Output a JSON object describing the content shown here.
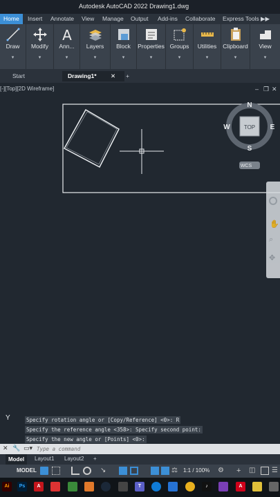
{
  "window": {
    "title": "Autodesk AutoCAD 2022   Drawing1.dwg"
  },
  "ribbon_tabs": [
    "Home",
    "Insert",
    "Annotate",
    "View",
    "Manage",
    "Output",
    "Add-ins",
    "Collaborate",
    "Express Tools"
  ],
  "ribbon_panels": [
    "Draw",
    "Modify",
    "Ann...",
    "Layers",
    "Block",
    "Properties",
    "Groups",
    "Utilities",
    "Clipboard",
    "View"
  ],
  "doc_tabs": {
    "start": "Start",
    "current": "Drawing1*",
    "close": "✕",
    "add": "+"
  },
  "viewport": {
    "label": "[-][Top][2D Wireframe]"
  },
  "viewcube": {
    "n": "N",
    "s": "S",
    "e": "E",
    "w": "W",
    "face": "TOP",
    "wcs": "WCS"
  },
  "command": {
    "history": [
      "Specify rotation angle or [Copy/Reference] <0>: R",
      "Specify the reference angle <358>:  Specify second point:",
      "Specify the new angle or [Points] <0>:"
    ],
    "placeholder": "Type a command"
  },
  "layout_tabs": [
    "Model",
    "Layout1",
    "Layout2"
  ],
  "status": {
    "model": "MODEL",
    "scale": "1:1 / 100%"
  },
  "colors": {
    "accent": "#3c8fd6",
    "canvas": "#212830",
    "ribbon": "#3a424c"
  }
}
